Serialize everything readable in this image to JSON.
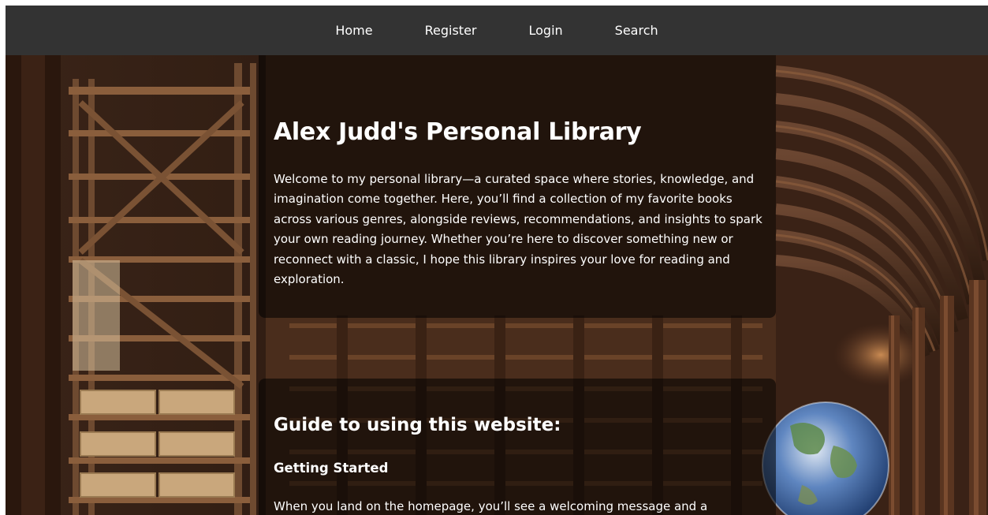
{
  "nav": {
    "home": "Home",
    "register": "Register",
    "login": "Login",
    "search": "Search"
  },
  "hero": {
    "title": "Alex Judd's Personal Library",
    "text": "Welcome to my personal library—a curated space where stories, knowledge, and imagination come together. Here, you’ll find a collection of my favorite books across various genres, alongside reviews, recommendations, and insights to spark your own reading journey. Whether you’re here to discover something new or reconnect with a classic, I hope this library inspires your love for reading and exploration."
  },
  "guide": {
    "title": "Guide to using this website:",
    "subtitle": "Getting Started",
    "text": "When you land on the homepage, you’ll see a welcoming message and a"
  },
  "colors": {
    "nav_bg": "#333333",
    "panel_bg": "rgba(0,0,0,0.55)",
    "text": "#ffffff"
  },
  "background": {
    "image": "library-hall-image"
  }
}
